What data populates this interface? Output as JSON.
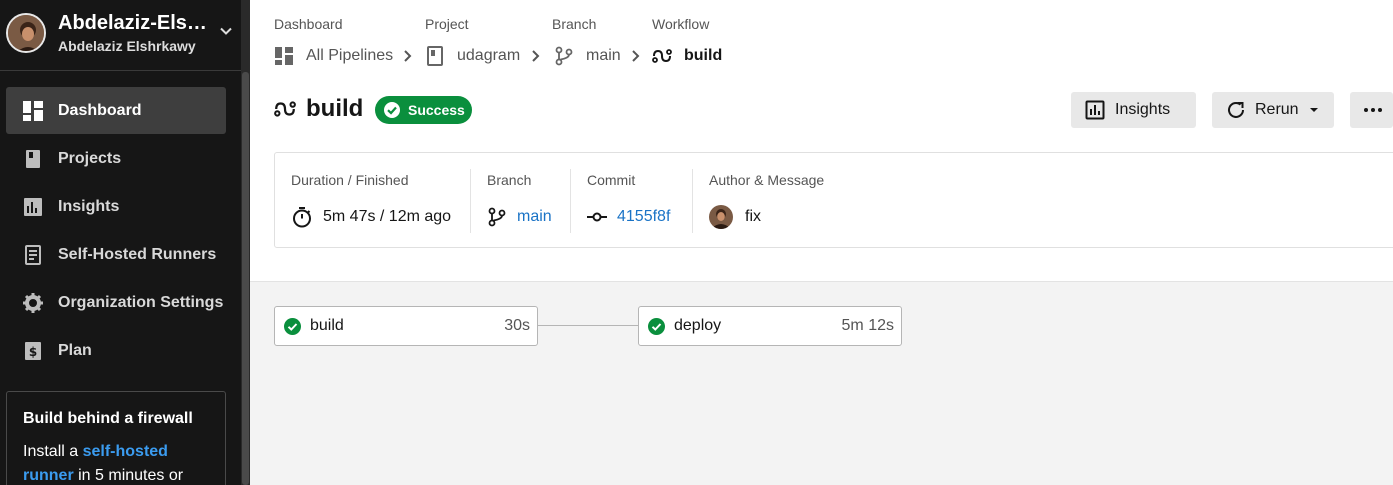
{
  "sidebar": {
    "org_name": "Abdelaziz-Els…",
    "user_name": "Abdelaziz Elshrkawy",
    "items": [
      {
        "label": "Dashboard",
        "icon": "dashboard-icon",
        "active": true
      },
      {
        "label": "Projects",
        "icon": "book-icon",
        "active": false
      },
      {
        "label": "Insights",
        "icon": "bar-chart-icon",
        "active": false
      },
      {
        "label": "Self-Hosted Runners",
        "icon": "runner-icon",
        "active": false
      },
      {
        "label": "Organization Settings",
        "icon": "gear-icon",
        "active": false
      },
      {
        "label": "Plan",
        "icon": "dollar-icon",
        "active": false
      }
    ],
    "promo": {
      "title": "Build behind a firewall",
      "text_before": "Install a",
      "link": "self-hosted runner",
      "text_after": "in 5 minutes or"
    }
  },
  "breadcrumb": {
    "labels": [
      "Dashboard",
      "Project",
      "Branch",
      "Workflow"
    ],
    "items": [
      "All Pipelines",
      "udagram",
      "main",
      "build"
    ]
  },
  "workflow": {
    "title": "build",
    "status": "Success"
  },
  "buttons": {
    "insights": "Insights",
    "rerun": "Rerun"
  },
  "details": {
    "duration_label": "Duration / Finished",
    "duration_value": "5m 47s / 12m ago",
    "branch_label": "Branch",
    "branch_value": "main",
    "commit_label": "Commit",
    "commit_value": "4155f8f",
    "author_label": "Author & Message",
    "message": "fix"
  },
  "jobs": [
    {
      "name": "build",
      "duration": "30s",
      "status": "success"
    },
    {
      "name": "deploy",
      "duration": "5m 12s",
      "status": "success"
    }
  ],
  "colors": {
    "success": "#0a8f3d",
    "link": "#1a73c6",
    "sidebar_bg": "#161616"
  }
}
